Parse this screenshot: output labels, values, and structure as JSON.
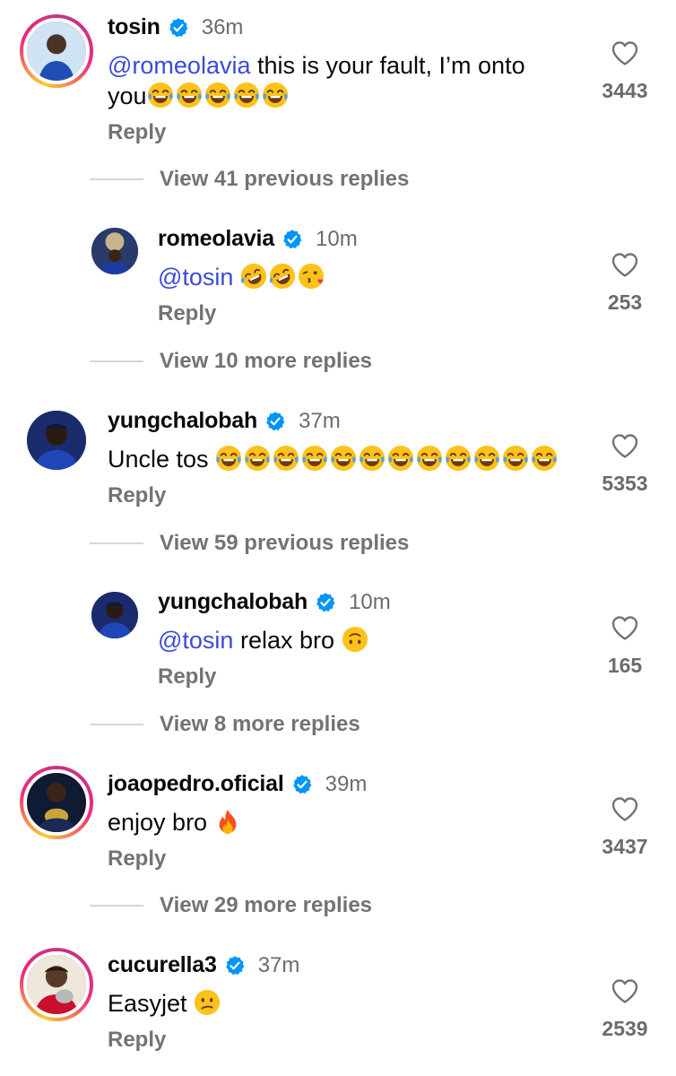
{
  "comments": [
    {
      "username": "tosin",
      "time": "36m",
      "mention": "@romeolavia",
      "text_line1": " this is your fault, I’m onto",
      "text_line2": "you",
      "emojis": [
        "joy",
        "joy",
        "joy",
        "joy",
        "joy"
      ],
      "reply": "Reply",
      "likes": "3443",
      "view_more": "View 41 previous replies"
    },
    {
      "username": "romeolavia",
      "time": "10m",
      "mention": "@tosin",
      "text": "",
      "emojis": [
        "rofl",
        "rofl",
        "kissing-heart"
      ],
      "reply": "Reply",
      "likes": "253",
      "view_more": "View 10 more replies"
    },
    {
      "username": "yungchalobah",
      "time": "37m",
      "text": "Uncle tos",
      "emojis": [
        "joy",
        "joy",
        "joy",
        "joy",
        "joy",
        "joy",
        "joy",
        "joy",
        "joy",
        "joy",
        "joy",
        "joy"
      ],
      "reply": "Reply",
      "likes": "5353",
      "view_more": "View 59 previous replies"
    },
    {
      "username": "yungchalobah",
      "time": "10m",
      "mention": "@tosin",
      "text": " relax bro",
      "emojis": [
        "upside-down"
      ],
      "reply": "Reply",
      "likes": "165",
      "view_more": "View 8 more replies"
    },
    {
      "username": "joaopedro.oficial",
      "time": "39m",
      "text": "enjoy bro",
      "emojis": [
        "fire"
      ],
      "reply": "Reply",
      "likes": "3437",
      "view_more": "View 29 more replies"
    },
    {
      "username": "cucurella3",
      "time": "37m",
      "text": "Easyjet",
      "emojis": [
        "confused"
      ],
      "reply": "Reply",
      "likes": "2539"
    }
  ],
  "colors": {
    "mention": "#3b4bd8",
    "verified": "#0095f6",
    "muted": "#737373"
  },
  "icons": {
    "verified": "verified-badge-icon",
    "like": "heart-outline-icon"
  }
}
